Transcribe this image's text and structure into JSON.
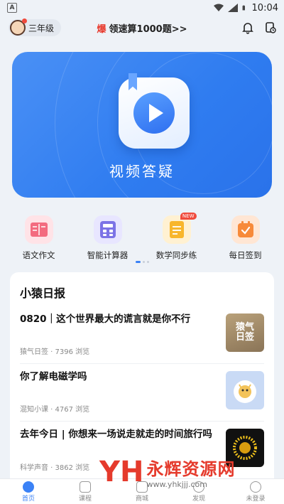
{
  "status_bar": {
    "time": "10:04"
  },
  "top_bar": {
    "grade": "三年级",
    "promo_icon": "爆",
    "promo_text": "领速算1000题>>",
    "icons": [
      "bell-icon",
      "history-icon"
    ]
  },
  "hero": {
    "title": "视频答疑",
    "icon": "video-play-icon"
  },
  "features": [
    {
      "label": "语文作文",
      "icon": "book-icon",
      "color": "#f36b7f"
    },
    {
      "label": "智能计算器",
      "icon": "calculator-icon",
      "color": "#7c73e6"
    },
    {
      "label": "数学同步练",
      "icon": "notebook-icon",
      "color": "#f8b62c",
      "badge": "NEW"
    },
    {
      "label": "每日签到",
      "icon": "calendar-check-icon",
      "color": "#f78a3a"
    }
  ],
  "carousel": {
    "page": 1,
    "total": 3
  },
  "news": {
    "heading": "小猿日报",
    "items": [
      {
        "title": "0820｜这个世界最大的谎言就是你不行",
        "meta": "猿气日签 · 7396 浏览",
        "thumb_text": "猿气日签"
      },
      {
        "title": "你了解电磁学吗",
        "meta": "混知小课 · 4767 浏览",
        "thumb_text": ""
      },
      {
        "title": "去年今日 | 你想来一场说走就走的时间旅行吗",
        "meta": "科学声音 · 3862 浏览",
        "thumb_text": ""
      }
    ]
  },
  "tabs": [
    {
      "label": "首页",
      "icon": "home-icon",
      "active": true
    },
    {
      "label": "课程",
      "icon": "play-box-icon",
      "active": false
    },
    {
      "label": "商城",
      "icon": "shop-icon",
      "active": false
    },
    {
      "label": "发现",
      "icon": "compass-icon",
      "active": false
    },
    {
      "label": "未登录",
      "icon": "user-icon",
      "active": false
    }
  ],
  "watermark": {
    "logo": "YH",
    "name": "永辉资源网",
    "url": "www.yhkjjj.com"
  },
  "colors": {
    "accent": "#3b82f6",
    "hero": "#2f7cf0",
    "promo": "#e8392c"
  }
}
